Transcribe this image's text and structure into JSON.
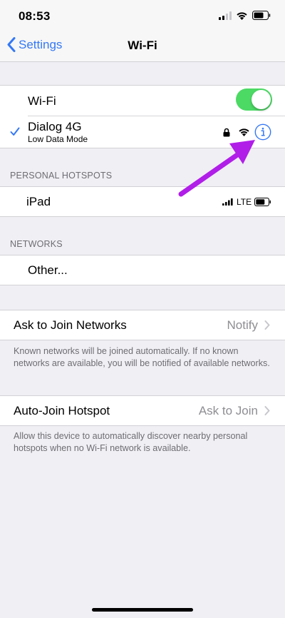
{
  "status_bar": {
    "time": "08:53"
  },
  "nav": {
    "back_label": "Settings",
    "title": "Wi-Fi"
  },
  "wifi_group": {
    "wifi_label": "Wi-Fi",
    "wifi_enabled": true,
    "connected_network": {
      "name": "Dialog 4G",
      "subtitle": "Low Data Mode"
    }
  },
  "personal_hotspots": {
    "header": "PERSONAL HOTSPOTS",
    "items": [
      {
        "name": "iPad",
        "network_type": "LTE"
      }
    ]
  },
  "networks": {
    "header": "NETWORKS",
    "other_label": "Other..."
  },
  "ask_to_join": {
    "label": "Ask to Join Networks",
    "value": "Notify",
    "footer": "Known networks will be joined automatically. If no known networks are available, you will be notified of available networks."
  },
  "auto_join": {
    "label": "Auto-Join Hotspot",
    "value": "Ask to Join",
    "footer": "Allow this device to automatically discover nearby personal hotspots when no Wi-Fi network is available."
  },
  "colors": {
    "accent": "#3478f6",
    "toggle_on": "#4cd964",
    "annotation_arrow": "#b01ee8",
    "background": "#efeff4"
  }
}
